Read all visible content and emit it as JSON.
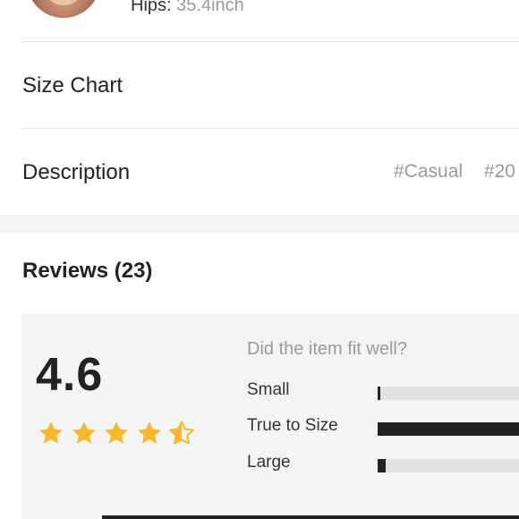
{
  "model": {
    "hips_label": "Hips:",
    "hips_value": "35.4inch"
  },
  "rows": {
    "size_chart": "Size Chart",
    "description": "Description"
  },
  "description_tags": [
    "#Casual",
    "#20"
  ],
  "reviews": {
    "title": "Reviews (23)",
    "rating": "4.6",
    "rating_value": 4.6,
    "stars_max": 5,
    "fit_question": "Did the item fit well?",
    "fit": [
      {
        "label": "Small",
        "fraction": 0.02
      },
      {
        "label": "True to Size",
        "fraction": 1.0
      },
      {
        "label": "Large",
        "fraction": 0.06
      }
    ]
  },
  "colors": {
    "star": "#F5B82E",
    "bar_fill": "#222222",
    "bar_track": "#E2E2E2",
    "muted_text": "#9A9A9A",
    "panel_bg": "#F4F4F4"
  }
}
